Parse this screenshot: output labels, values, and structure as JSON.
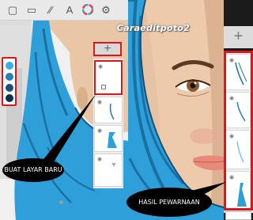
{
  "left_panel": {
    "toolbar_icons": [
      "brush-icon",
      "layers-icon",
      "pen-tools-icon",
      "brush-size-icon",
      "color-wheel-icon",
      "settings-icon"
    ],
    "add_layer_label": "+",
    "swatch_colors": [
      "#3aaee6",
      "#2a7fb6",
      "#1b4f7a",
      "#0f2e4e"
    ]
  },
  "right_panel": {
    "add_layer_label": "+"
  },
  "watermark": "Caraeditpoto2",
  "callouts": {
    "new_layer": "BUAT LAYAR BARU",
    "result": "HASIL PEWARNAAN"
  },
  "colors": {
    "accent_red": "#e0141c",
    "hijab_blue": "#2e9fd9",
    "skin": "#e6c3a4"
  }
}
